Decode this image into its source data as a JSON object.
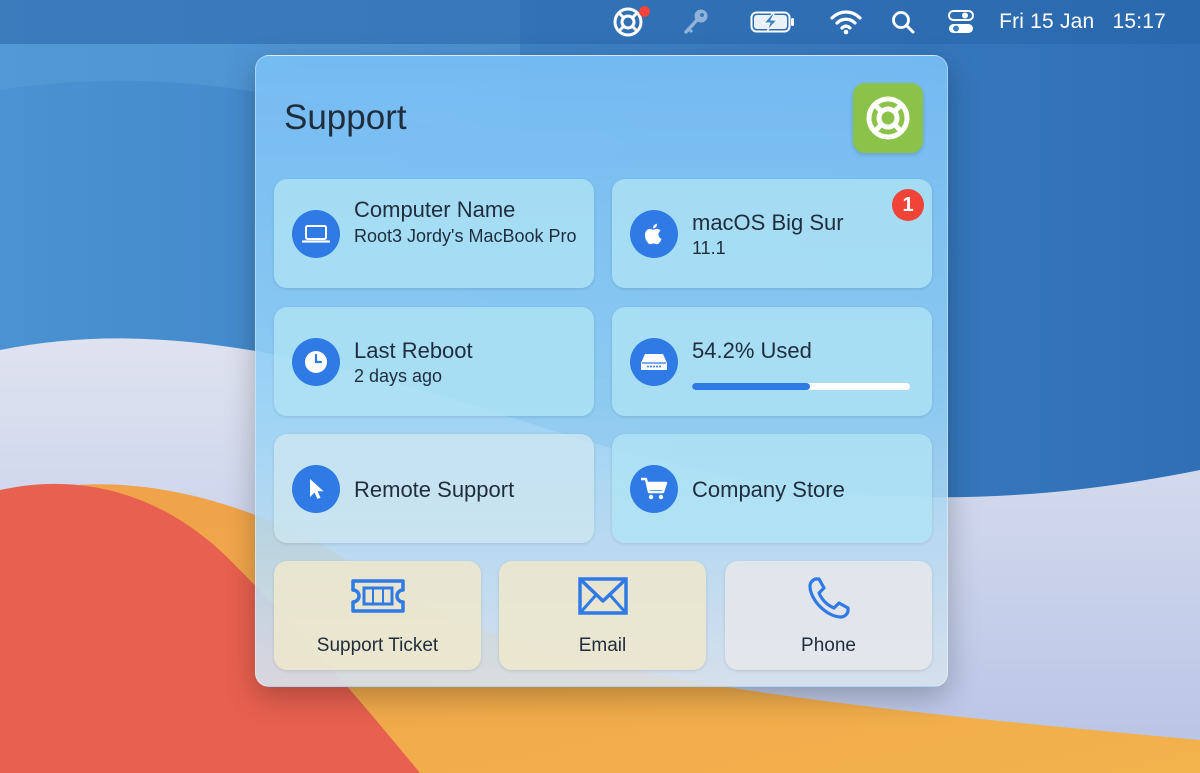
{
  "colors": {
    "accent": "#2f7ae5",
    "badge": "#ef4437",
    "app_icon_bg": "#8bc34a",
    "menubar_dot": "#f0443a"
  },
  "menubar": {
    "icons": [
      "lifebuoy-icon",
      "key-icon",
      "battery-charging-icon",
      "wifi-icon",
      "search-icon",
      "control-center-icon"
    ],
    "date": "Fri 15 Jan",
    "time": "15:17"
  },
  "panel": {
    "title": "Support",
    "app_icon": "lifebuoy-icon"
  },
  "tiles": {
    "computer_name": {
      "icon": "laptop-icon",
      "title": "Computer Name",
      "value": "Root3 Jordy's MacBook Pro"
    },
    "macos": {
      "icon": "apple-icon",
      "title": "macOS Big Sur",
      "value": "11.1",
      "badge": "1"
    },
    "last_reboot": {
      "icon": "clock-icon",
      "title": "Last Reboot",
      "value": "2 days ago"
    },
    "storage": {
      "icon": "disk-icon",
      "title": "54.2% Used",
      "used_fraction": 0.542
    },
    "remote_support": {
      "icon": "cursor-icon",
      "title": "Remote Support"
    },
    "company_store": {
      "icon": "cart-icon",
      "title": "Company Store"
    }
  },
  "actions": [
    {
      "icon": "ticket-icon",
      "label": "Support Ticket"
    },
    {
      "icon": "envelope-icon",
      "label": "Email"
    },
    {
      "icon": "phone-icon",
      "label": "Phone"
    }
  ]
}
